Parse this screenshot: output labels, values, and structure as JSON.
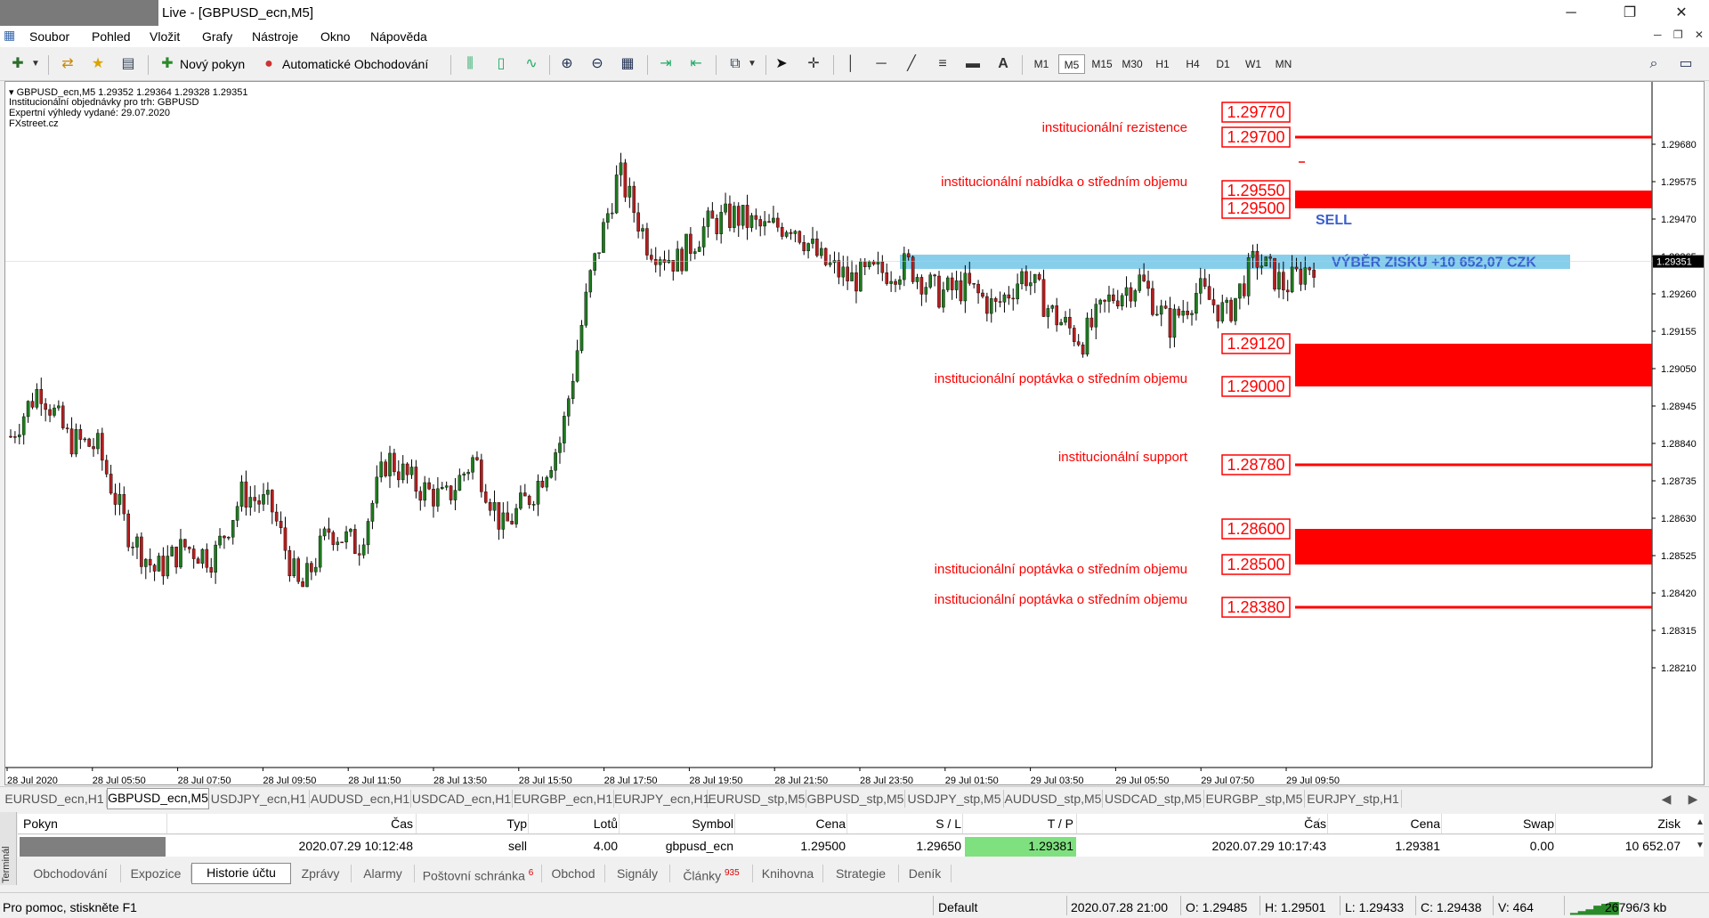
{
  "window": {
    "title": "Live - [GBPUSD_ecn,M5]"
  },
  "menu": [
    "Soubor",
    "Pohled",
    "Vložit",
    "Grafy",
    "Nástroje",
    "Okno",
    "Nápověda"
  ],
  "toolbar": {
    "new_order": "Nový pokyn",
    "auto_trading": "Automatické Obchodování",
    "draw_text_tool": "A",
    "timeframes": [
      "M1",
      "M5",
      "M15",
      "M30",
      "H1",
      "H4",
      "D1",
      "W1",
      "MN"
    ],
    "active_timeframe": "M5"
  },
  "chart": {
    "symbol_info": "GBPUSD_ecn,M5  1.29352 1.29364 1.29328 1.29351",
    "info_lines": [
      "Institucionální objednávky pro trh: GBPUSD",
      "Expertní výhledy vydané: 29.07.2020",
      "FXstreet.cz"
    ],
    "current_price": "1.29351",
    "colors": {
      "level": "#ff0000",
      "zone": "#ff0000",
      "band": "#87ceeb",
      "text": "#ff0000",
      "annotation": "#3a5fcd"
    },
    "price_axis": [
      "1.29680",
      "1.29575",
      "1.29470",
      "1.29365",
      "1.29260",
      "1.29155",
      "1.29050",
      "1.28945",
      "1.28840",
      "1.28735",
      "1.28630",
      "1.28525",
      "1.28420",
      "1.28315",
      "1.28210"
    ],
    "time_axis": [
      "28 Jul 2020",
      "28 Jul 05:50",
      "28 Jul 07:50",
      "28 Jul 09:50",
      "28 Jul 11:50",
      "28 Jul 13:50",
      "28 Jul 15:50",
      "28 Jul 17:50",
      "28 Jul 19:50",
      "28 Jul 21:50",
      "28 Jul 23:50",
      "29 Jul 01:50",
      "29 Jul 03:50",
      "29 Jul 05:50",
      "29 Jul 07:50",
      "29 Jul 09:50"
    ],
    "levels": [
      {
        "price": "1.29770",
        "label": ""
      },
      {
        "price": "1.29700",
        "label": "institucionální rezistence"
      },
      {
        "price": "1.29550",
        "label": "institucionální nabídka o středním objemu"
      },
      {
        "price": "1.29500",
        "label": ""
      },
      {
        "price": "1.29120",
        "label": ""
      },
      {
        "price": "1.29000",
        "label": "institucionální poptávka o středním objemu"
      },
      {
        "price": "1.28780",
        "label": "institucionální support"
      },
      {
        "price": "1.28600",
        "label": ""
      },
      {
        "price": "1.28500",
        "label": "institucionální poptávka o středním objemu"
      },
      {
        "price": "1.28380",
        "label": "institucionální poptávka o středním objemu"
      }
    ],
    "annotations": {
      "sell": "SELL",
      "profit": "VÝBĚR ZISKU +10 652,07 CZK"
    }
  },
  "chart_data": {
    "type": "candlestick",
    "symbol": "GBPUSD_ecn",
    "timeframe": "M5",
    "ylim": [
      1.2817,
      1.2977
    ],
    "x_labels": [
      "28 Jul 2020",
      "28 Jul 05:50",
      "28 Jul 07:50",
      "28 Jul 09:50",
      "28 Jul 11:50",
      "28 Jul 13:50",
      "28 Jul 15:50",
      "28 Jul 17:50",
      "28 Jul 19:50",
      "28 Jul 21:50",
      "28 Jul 23:50",
      "29 Jul 01:50",
      "29 Jul 03:50",
      "29 Jul 05:50",
      "29 Jul 07:50",
      "29 Jul 09:50"
    ],
    "close_path": [
      1.2886,
      1.29,
      1.2885,
      1.2883,
      1.286,
      1.2848,
      1.2855,
      1.2852,
      1.287,
      1.2866,
      1.2842,
      1.286,
      1.2855,
      1.288,
      1.2872,
      1.2868,
      1.288,
      1.286,
      1.287,
      1.2885,
      1.293,
      1.296,
      1.294,
      1.2935,
      1.2945,
      1.2948,
      1.2944,
      1.2946,
      1.2935,
      1.293,
      1.2932,
      1.2934,
      1.2926,
      1.2928,
      1.2922,
      1.2932,
      1.292,
      1.2913,
      1.2925,
      1.293,
      1.2917,
      1.2927,
      1.292,
      1.2936,
      1.2928,
      1.2935
    ],
    "zones": [
      [
        1.295,
        1.2955
      ],
      [
        1.29,
        1.2912
      ],
      [
        1.285,
        1.286
      ]
    ],
    "band": [
      1.2933,
      1.2937
    ]
  },
  "symbol_tabs": [
    "EURUSD_ecn,H1",
    "GBPUSD_ecn,M5",
    "USDJPY_ecn,H1",
    "AUDUSD_ecn,H1",
    "USDCAD_ecn,H1",
    "EURGBP_ecn,H1",
    "EURJPY_ecn,H1",
    "EURUSD_stp,M5",
    "GBPUSD_stp,M5",
    "USDJPY_stp,M5",
    "AUDUSD_stp,M5",
    "USDCAD_stp,M5",
    "EURGBP_stp,M5",
    "EURJPY_stp,H1"
  ],
  "active_symbol_tab": "GBPUSD_ecn,M5",
  "terminal": {
    "side_label": "Terminál",
    "headers": [
      "Pokyn",
      "Čas",
      "Typ",
      "Lotů",
      "Symbol",
      "Cena",
      "S / L",
      "T / P",
      "Čas",
      "Cena",
      "Swap",
      "Zisk"
    ],
    "row": [
      "",
      "2020.07.29 10:12:48",
      "sell",
      "4.00",
      "gbpusd_ecn",
      "1.29500",
      "1.29650",
      "1.29381",
      "2020.07.29 10:17:43",
      "1.29381",
      "0.00",
      "10 652.07"
    ],
    "tabs": [
      {
        "label": "Obchodování",
        "badge": ""
      },
      {
        "label": "Expozice",
        "badge": ""
      },
      {
        "label": "Historie účtu",
        "badge": ""
      },
      {
        "label": "Zprávy",
        "badge": ""
      },
      {
        "label": "Alarmy",
        "badge": ""
      },
      {
        "label": "Poštovní schránka",
        "badge": "6"
      },
      {
        "label": "Obchod",
        "badge": ""
      },
      {
        "label": "Signály",
        "badge": ""
      },
      {
        "label": "Články",
        "badge": "935"
      },
      {
        "label": "Knihovna",
        "badge": ""
      },
      {
        "label": "Strategie",
        "badge": ""
      },
      {
        "label": "Deník",
        "badge": ""
      }
    ],
    "active_tab": "Historie účtu"
  },
  "status": {
    "help": "Pro pomoc, stiskněte F1",
    "profile": "Default",
    "datetime": "2020.07.28 21:00",
    "open": "O: 1.29485",
    "high": "H: 1.29501",
    "low": "L: 1.29433",
    "close": "C: 1.29438",
    "volume": "V: 464",
    "traffic": "26796/3 kb"
  }
}
